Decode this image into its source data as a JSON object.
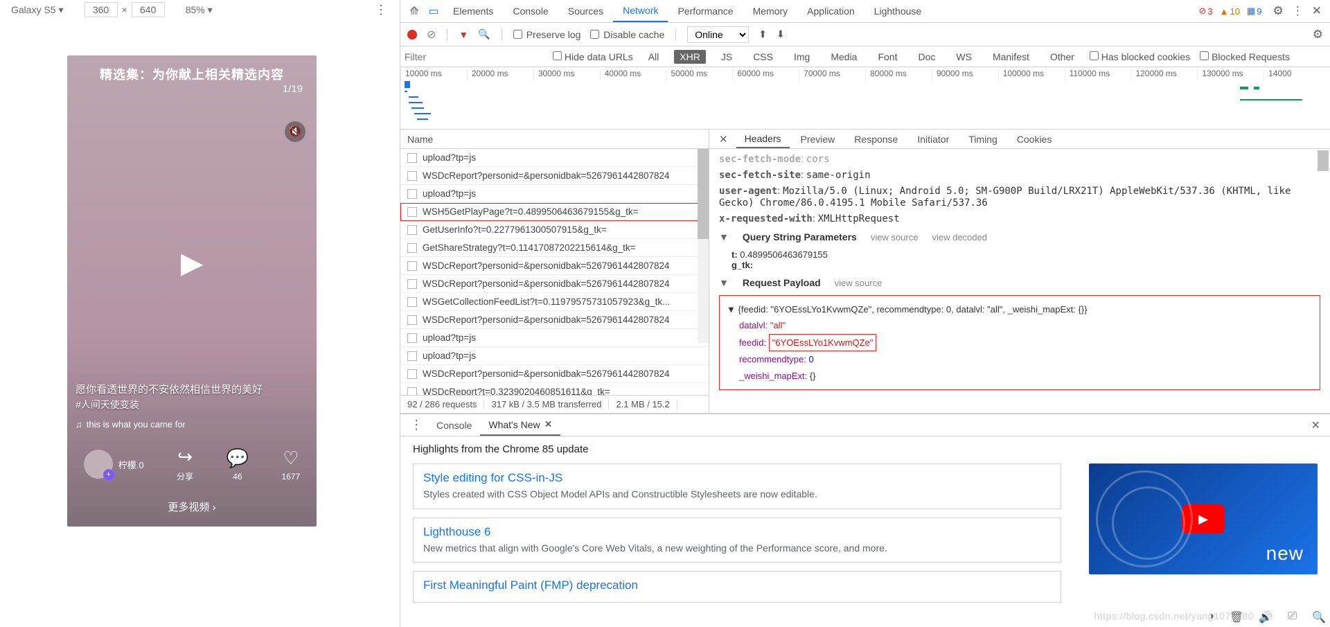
{
  "device_toolbar": {
    "device": "Galaxy S5 ▾",
    "width": "360",
    "height": "640",
    "times": "×",
    "zoom": "85% ▾"
  },
  "phone": {
    "title": "精选集：为你献上相关精选内容",
    "counter": "1/19",
    "caption_line1": "愿你看透世界的不安依然相信世界的美好",
    "hashtag": "#人间天使变装",
    "music_prefix": "♫",
    "music": "this is what you came for",
    "user": "柠檬.0",
    "share_label": "分享",
    "comments": "46",
    "likes": "1677",
    "more": "更多视频 ›"
  },
  "devtools_tabs": [
    "Elements",
    "Console",
    "Sources",
    "Network",
    "Performance",
    "Memory",
    "Application",
    "Lighthouse"
  ],
  "devtools_active_tab": "Network",
  "status_counts": {
    "errors": "3",
    "warnings": "10",
    "info": "9"
  },
  "net_toolbar": {
    "preserve_log": "Preserve log",
    "disable_cache": "Disable cache",
    "throttle": "Online"
  },
  "filter": {
    "placeholder": "Filter",
    "hide_data_urls": "Hide data URLs",
    "chips": [
      "All",
      "XHR",
      "JS",
      "CSS",
      "Img",
      "Media",
      "Font",
      "Doc",
      "WS",
      "Manifest",
      "Other"
    ],
    "active_chip": "XHR",
    "blocked_cookies": "Has blocked cookies",
    "blocked_requests": "Blocked Requests"
  },
  "timeline_ticks": [
    "10000 ms",
    "20000 ms",
    "30000 ms",
    "40000 ms",
    "50000 ms",
    "60000 ms",
    "70000 ms",
    "80000 ms",
    "90000 ms",
    "100000 ms",
    "110000 ms",
    "120000 ms",
    "130000 ms",
    "14000"
  ],
  "requests": {
    "header": "Name",
    "rows": [
      {
        "name": "upload?tp=js"
      },
      {
        "name": "WSDcReport?personid=&personidbak=5267961442807824"
      },
      {
        "name": "upload?tp=js"
      },
      {
        "name": "WSH5GetPlayPage?t=0.4899506463679155&g_tk=",
        "selected": true
      },
      {
        "name": "GetUserInfo?t=0.2277961300507915&g_tk="
      },
      {
        "name": "GetShareStrategy?t=0.11417087202215614&g_tk="
      },
      {
        "name": "WSDcReport?personid=&personidbak=5267961442807824"
      },
      {
        "name": "WSDcReport?personid=&personidbak=5267961442807824"
      },
      {
        "name": "WSGetCollectionFeedList?t=0.11979575731057923&g_tk..."
      },
      {
        "name": "WSDcReport?personid=&personidbak=5267961442807824"
      },
      {
        "name": "upload?tp=js"
      },
      {
        "name": "upload?tp=js"
      },
      {
        "name": "WSDcReport?personid=&personidbak=5267961442807824"
      },
      {
        "name": "WSDcReport?t=0.3239020460851611&g_tk="
      }
    ],
    "status_bar": {
      "count": "92 / 286 requests",
      "transferred": "317 kB / 3.5 MB transferred",
      "resources": "2.1 MB / 15.2"
    }
  },
  "details": {
    "tabs": [
      "Headers",
      "Preview",
      "Response",
      "Initiator",
      "Timing",
      "Cookies"
    ],
    "active": "Headers",
    "headers_frag": {
      "sec_fetch_mode_key": "sec-fetch-mode",
      "sec_fetch_mode_value": "cors",
      "sec_fetch_site_key": "sec-fetch-site",
      "sec_fetch_site_value": "same-origin",
      "ua_key": "user-agent",
      "ua_value": "Mozilla/5.0 (Linux; Android 5.0; SM-G900P Build/LRX21T) AppleWebKit/537.36 (KHTML, like Gecko) Chrome/86.0.4195.1 Mobile Safari/537.36",
      "xrw_key": "x-requested-with",
      "xrw_value": "XMLHttpRequest"
    },
    "query_section": {
      "title": "Query String Parameters",
      "view_source": "view source",
      "view_decoded": "view decoded",
      "t_key": "t:",
      "t_value": "0.4899506463679155",
      "g_tk_key": "g_tk:"
    },
    "payload_section": {
      "title": "Request Payload",
      "view_source": "view source",
      "summary": "{feedid: \"6YOEssLYo1KvwmQZe\", recommendtype: 0, datalvl: \"all\", _weishi_mapExt: {}}",
      "datalvl_key": "datalvl:",
      "datalvl_value": "\"all\"",
      "feedid_key": "feedid:",
      "feedid_value": "\"6YOEssLYo1KvwmQZe\"",
      "recommend_key": "recommendtype:",
      "recommend_value": "0",
      "mapext_key": "_weishi_mapExt:",
      "mapext_value": "{}"
    }
  },
  "drawer": {
    "tabs": {
      "console": "Console",
      "whatsnew": "What's New"
    },
    "active": "What's New",
    "heading": "Highlights from the Chrome 85 update",
    "cards": [
      {
        "title": "Style editing for CSS-in-JS",
        "desc": "Styles created with CSS Object Model APIs and Constructible Stylesheets are now editable."
      },
      {
        "title": "Lighthouse 6",
        "desc": "New metrics that align with Google's Core Web Vitals, a new weighting of the Performance score, and more."
      },
      {
        "title": "First Meaningful Paint (FMP) deprecation",
        "desc": ""
      }
    ],
    "promo_text": "new"
  },
  "watermark": "https://blog.csdn.net/yang1076180"
}
